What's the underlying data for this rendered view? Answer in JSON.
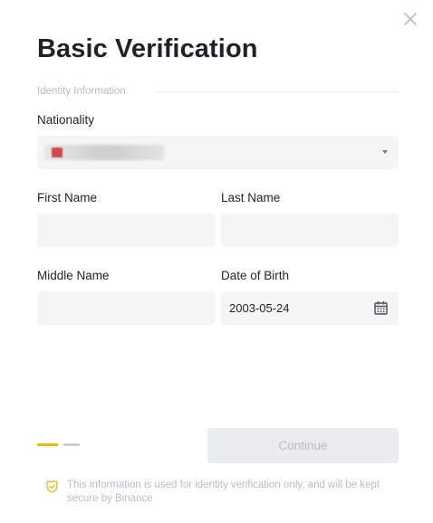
{
  "dialog": {
    "title": "Basic Verification",
    "close_icon": "close-icon"
  },
  "section": {
    "label": "Identity Information"
  },
  "nationality": {
    "label": "Nationality",
    "value_redacted": true,
    "dropdown_icon": "caret-down-icon"
  },
  "first_name": {
    "label": "First Name",
    "value": "",
    "value_redacted": true
  },
  "last_name": {
    "label": "Last Name",
    "value": "",
    "value_redacted": true
  },
  "middle_name": {
    "label": "Middle Name",
    "value": ""
  },
  "date_of_birth": {
    "label": "Date of Birth",
    "value": "2003-05-24",
    "icon": "calendar-icon"
  },
  "progress": {
    "current_step": 1,
    "total_steps": 2,
    "active_color": "#f0b90b",
    "inactive_color": "#c9cdd3"
  },
  "continue_button": {
    "label": "Continue",
    "enabled": false
  },
  "footer": {
    "icon": "shield-check-icon",
    "note": "This information is used for identity verification only,  and will be kept secure by Binance"
  },
  "colors": {
    "accent": "#f0b90b",
    "field_bg": "#f5f5f5",
    "muted_text": "#b7bdc6",
    "text": "#1e2329"
  }
}
